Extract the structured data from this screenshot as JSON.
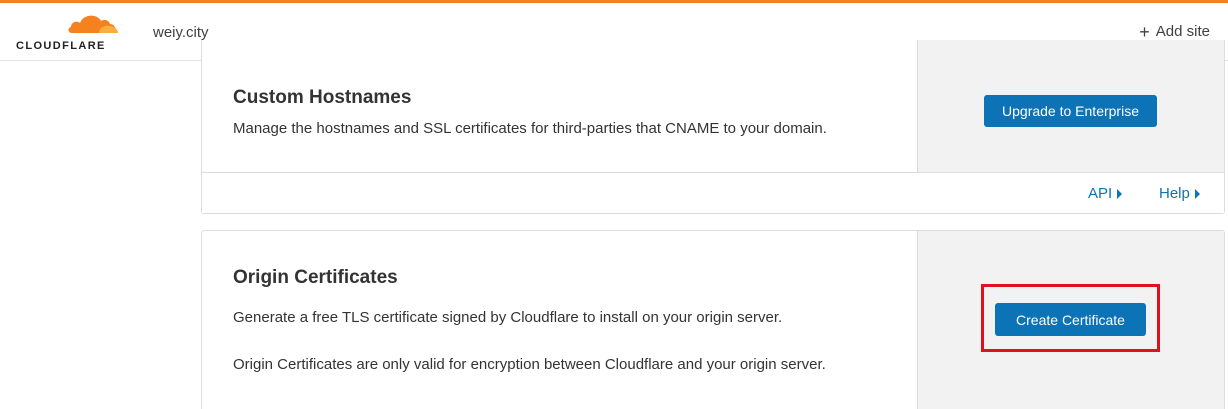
{
  "header": {
    "logo_text": "CLOUDFLARE",
    "zone": "weiy.city",
    "add_site_label": "Add site",
    "add_site_icon": "plus-icon"
  },
  "custom_hostnames": {
    "title": "Custom Hostnames",
    "description": "Manage the hostnames and SSL certificates for third-parties that CNAME to your domain.",
    "button_label": "Upgrade to Enterprise",
    "links": [
      {
        "label": "API",
        "icon": "caret-right-icon"
      },
      {
        "label": "Help",
        "icon": "caret-right-icon"
      }
    ]
  },
  "origin_certificates": {
    "title": "Origin Certificates",
    "description_1": "Generate a free TLS certificate signed by Cloudflare to install on your origin server.",
    "description_2": "Origin Certificates are only valid for encryption between Cloudflare and your origin server.",
    "button_label": "Create Certificate"
  },
  "colors": {
    "accent": "#f6821f",
    "primary_button": "#0b73b6",
    "link": "#0b73b6",
    "highlight": "#e0111f",
    "side_panel": "#f2f2f2"
  }
}
